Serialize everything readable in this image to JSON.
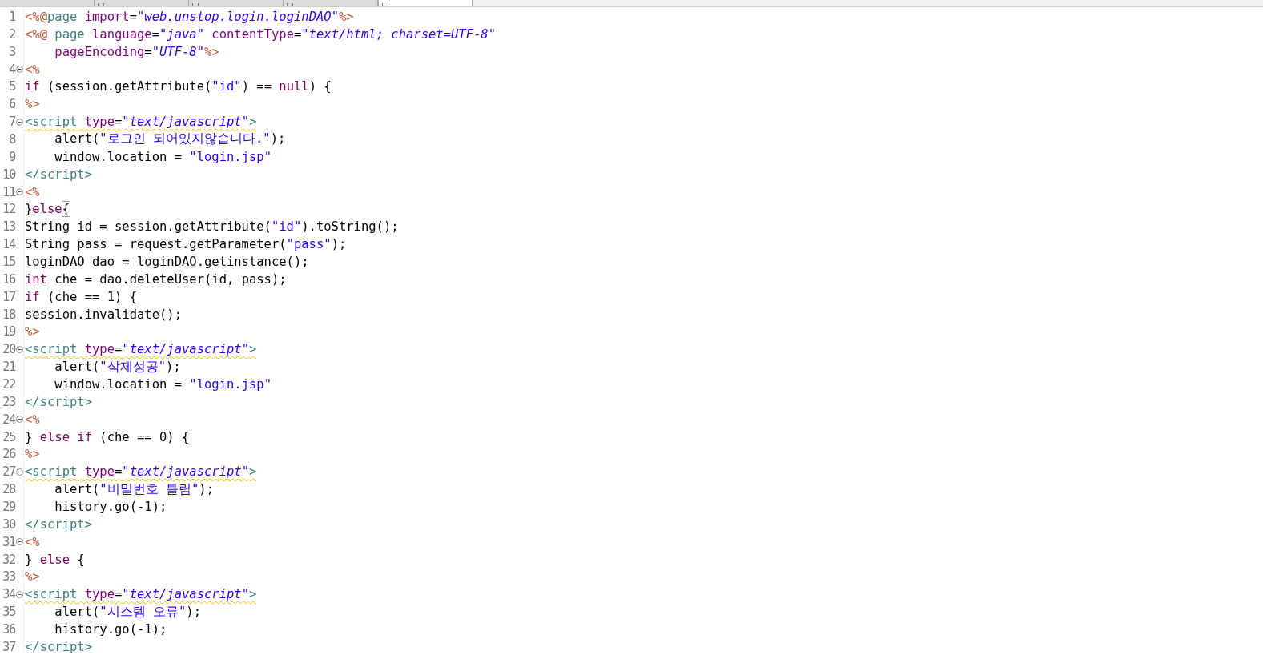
{
  "tabs": [
    {
      "selected": false
    },
    {
      "selected": false
    },
    {
      "selected": false
    },
    {
      "selected": false
    },
    {
      "selected": true
    }
  ],
  "editor": {
    "lines": [
      {
        "number": "1",
        "foldable": false,
        "warning": false,
        "tokens": [
          {
            "kind": "delim",
            "text": "<%@"
          },
          {
            "kind": "directive",
            "text": "page"
          },
          {
            "kind": "attr",
            "text": " import"
          },
          {
            "kind": "plain",
            "text": "="
          },
          {
            "kind": "value",
            "text": "\"web.unstop.login.loginDAO\""
          },
          {
            "kind": "delim",
            "text": "%>"
          }
        ]
      },
      {
        "number": "2",
        "foldable": false,
        "warning": false,
        "tokens": [
          {
            "kind": "delim",
            "text": "<%@"
          },
          {
            "kind": "directive",
            "text": " page"
          },
          {
            "kind": "attr",
            "text": " language"
          },
          {
            "kind": "plain",
            "text": "="
          },
          {
            "kind": "value",
            "text": "\"java\""
          },
          {
            "kind": "attr",
            "text": " contentType"
          },
          {
            "kind": "plain",
            "text": "="
          },
          {
            "kind": "value",
            "text": "\"text/html; charset=UTF-8\""
          }
        ]
      },
      {
        "number": "3",
        "foldable": false,
        "warning": false,
        "tokens": [
          {
            "kind": "attr",
            "text": "    pageEncoding"
          },
          {
            "kind": "plain",
            "text": "="
          },
          {
            "kind": "value",
            "text": "\"UTF-8\""
          },
          {
            "kind": "delim",
            "text": "%>"
          }
        ]
      },
      {
        "number": "4",
        "foldable": true,
        "warning": false,
        "tokens": [
          {
            "kind": "delim",
            "text": "<%"
          }
        ]
      },
      {
        "number": "5",
        "foldable": false,
        "warning": false,
        "tokens": [
          {
            "kind": "keyword",
            "text": "if"
          },
          {
            "kind": "plain",
            "text": " (session.getAttribute("
          },
          {
            "kind": "string",
            "text": "\"id\""
          },
          {
            "kind": "plain",
            "text": ") == "
          },
          {
            "kind": "keyword",
            "text": "null"
          },
          {
            "kind": "plain",
            "text": ") {"
          }
        ]
      },
      {
        "number": "6",
        "foldable": false,
        "warning": false,
        "tokens": [
          {
            "kind": "delim",
            "text": "%>"
          }
        ]
      },
      {
        "number": "7",
        "foldable": true,
        "warning": true,
        "tokens": [
          {
            "kind": "tag",
            "text": "<script"
          },
          {
            "kind": "attr",
            "text": " type"
          },
          {
            "kind": "plain",
            "text": "="
          },
          {
            "kind": "value",
            "text": "\"text/javascript\""
          },
          {
            "kind": "tag",
            "text": ">"
          }
        ]
      },
      {
        "number": "8",
        "foldable": false,
        "warning": false,
        "tokens": [
          {
            "kind": "plain",
            "text": "    alert("
          },
          {
            "kind": "string",
            "text": "\"로그인 되어있지않습니다.\""
          },
          {
            "kind": "plain",
            "text": ");"
          }
        ]
      },
      {
        "number": "9",
        "foldable": false,
        "warning": false,
        "tokens": [
          {
            "kind": "plain",
            "text": "    window.location = "
          },
          {
            "kind": "string",
            "text": "\"login.jsp\""
          }
        ]
      },
      {
        "number": "10",
        "foldable": false,
        "warning": false,
        "tokens": [
          {
            "kind": "tag",
            "text": "</script>"
          }
        ]
      },
      {
        "number": "11",
        "foldable": true,
        "warning": false,
        "tokens": [
          {
            "kind": "delim",
            "text": "<%"
          }
        ]
      },
      {
        "number": "12",
        "foldable": false,
        "warning": false,
        "tokens": [
          {
            "kind": "plain",
            "text": "}"
          },
          {
            "kind": "keyword",
            "text": "else"
          },
          {
            "kind": "bracket-match",
            "text": "{"
          }
        ]
      },
      {
        "number": "13",
        "foldable": false,
        "warning": false,
        "tokens": [
          {
            "kind": "plain",
            "text": "String id = session.getAttribute("
          },
          {
            "kind": "string",
            "text": "\"id\""
          },
          {
            "kind": "plain",
            "text": ").toString();"
          }
        ]
      },
      {
        "number": "14",
        "foldable": false,
        "warning": false,
        "tokens": [
          {
            "kind": "plain",
            "text": "String pass = request.getParameter("
          },
          {
            "kind": "string",
            "text": "\"pass\""
          },
          {
            "kind": "plain",
            "text": ");"
          }
        ]
      },
      {
        "number": "15",
        "foldable": false,
        "warning": false,
        "tokens": [
          {
            "kind": "plain",
            "text": "loginDAO dao = loginDAO.getinstance();"
          }
        ]
      },
      {
        "number": "16",
        "foldable": false,
        "warning": false,
        "tokens": [
          {
            "kind": "keyword",
            "text": "int"
          },
          {
            "kind": "plain",
            "text": " che = dao.deleteUser(id, pass);"
          }
        ]
      },
      {
        "number": "17",
        "foldable": false,
        "warning": false,
        "tokens": [
          {
            "kind": "keyword",
            "text": "if"
          },
          {
            "kind": "plain",
            "text": " (che == 1) {"
          }
        ]
      },
      {
        "number": "18",
        "foldable": false,
        "warning": false,
        "tokens": [
          {
            "kind": "plain",
            "text": "session.invalidate();"
          }
        ]
      },
      {
        "number": "19",
        "foldable": false,
        "warning": false,
        "tokens": [
          {
            "kind": "delim",
            "text": "%>"
          }
        ]
      },
      {
        "number": "20",
        "foldable": true,
        "warning": true,
        "tokens": [
          {
            "kind": "tag",
            "text": "<script"
          },
          {
            "kind": "attr",
            "text": " type"
          },
          {
            "kind": "plain",
            "text": "="
          },
          {
            "kind": "value",
            "text": "\"text/javascript\""
          },
          {
            "kind": "tag",
            "text": ">"
          }
        ]
      },
      {
        "number": "21",
        "foldable": false,
        "warning": false,
        "tokens": [
          {
            "kind": "plain",
            "text": "    alert("
          },
          {
            "kind": "string",
            "text": "\"삭제성공\""
          },
          {
            "kind": "plain",
            "text": ");"
          }
        ]
      },
      {
        "number": "22",
        "foldable": false,
        "warning": false,
        "tokens": [
          {
            "kind": "plain",
            "text": "    window.location = "
          },
          {
            "kind": "string",
            "text": "\"login.jsp\""
          }
        ]
      },
      {
        "number": "23",
        "foldable": false,
        "warning": false,
        "tokens": [
          {
            "kind": "tag",
            "text": "</script>"
          }
        ]
      },
      {
        "number": "24",
        "foldable": true,
        "warning": false,
        "tokens": [
          {
            "kind": "delim",
            "text": "<%"
          }
        ]
      },
      {
        "number": "25",
        "foldable": false,
        "warning": false,
        "tokens": [
          {
            "kind": "plain",
            "text": "} "
          },
          {
            "kind": "keyword",
            "text": "else if"
          },
          {
            "kind": "plain",
            "text": " (che == 0) {"
          }
        ]
      },
      {
        "number": "26",
        "foldable": false,
        "warning": false,
        "tokens": [
          {
            "kind": "delim",
            "text": "%>"
          }
        ]
      },
      {
        "number": "27",
        "foldable": true,
        "warning": true,
        "tokens": [
          {
            "kind": "tag",
            "text": "<script"
          },
          {
            "kind": "attr",
            "text": " type"
          },
          {
            "kind": "plain",
            "text": "="
          },
          {
            "kind": "value",
            "text": "\"text/javascript\""
          },
          {
            "kind": "tag",
            "text": ">"
          }
        ]
      },
      {
        "number": "28",
        "foldable": false,
        "warning": false,
        "tokens": [
          {
            "kind": "plain",
            "text": "    alert("
          },
          {
            "kind": "string",
            "text": "\"비밀번호 틀림\""
          },
          {
            "kind": "plain",
            "text": ");"
          }
        ]
      },
      {
        "number": "29",
        "foldable": false,
        "warning": false,
        "tokens": [
          {
            "kind": "plain",
            "text": "    history.go(-1);"
          }
        ]
      },
      {
        "number": "30",
        "foldable": false,
        "warning": false,
        "tokens": [
          {
            "kind": "tag",
            "text": "</script>"
          }
        ]
      },
      {
        "number": "31",
        "foldable": true,
        "warning": false,
        "tokens": [
          {
            "kind": "delim",
            "text": "<%"
          }
        ]
      },
      {
        "number": "32",
        "foldable": false,
        "warning": false,
        "tokens": [
          {
            "kind": "plain",
            "text": "} "
          },
          {
            "kind": "keyword",
            "text": "else"
          },
          {
            "kind": "plain",
            "text": " {"
          }
        ]
      },
      {
        "number": "33",
        "foldable": false,
        "warning": false,
        "tokens": [
          {
            "kind": "delim",
            "text": "%>"
          }
        ]
      },
      {
        "number": "34",
        "foldable": true,
        "warning": true,
        "tokens": [
          {
            "kind": "tag",
            "text": "<script"
          },
          {
            "kind": "attr",
            "text": " type"
          },
          {
            "kind": "plain",
            "text": "="
          },
          {
            "kind": "value",
            "text": "\"text/javascript\""
          },
          {
            "kind": "tag",
            "text": ">"
          }
        ]
      },
      {
        "number": "35",
        "foldable": false,
        "warning": false,
        "tokens": [
          {
            "kind": "plain",
            "text": "    alert("
          },
          {
            "kind": "string",
            "text": "\"시스템 오류\""
          },
          {
            "kind": "plain",
            "text": ");"
          }
        ]
      },
      {
        "number": "36",
        "foldable": false,
        "warning": false,
        "tokens": [
          {
            "kind": "plain",
            "text": "    history.go(-1);"
          }
        ]
      },
      {
        "number": "37",
        "foldable": false,
        "warning": false,
        "tokens": [
          {
            "kind": "tag",
            "text": "</script>"
          }
        ]
      }
    ]
  }
}
